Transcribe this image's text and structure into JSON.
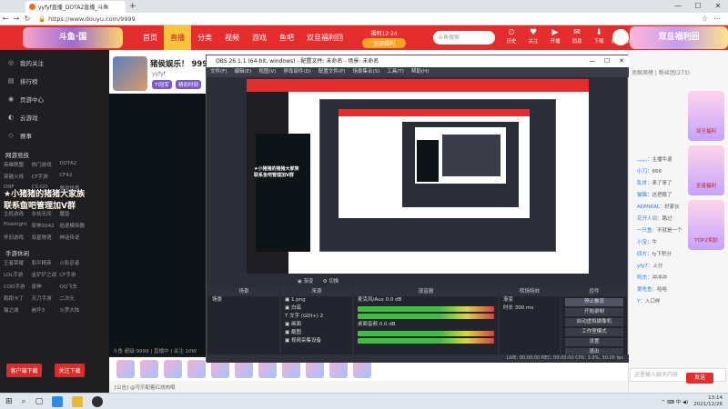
{
  "browser": {
    "tab_title": "yyfyf直播_DOTA2直播_斗鱼",
    "new_tab": "+",
    "window_buttons": [
      "—",
      "☐",
      "✕"
    ],
    "nav": [
      "←",
      "→",
      "↻"
    ],
    "url": "https://www.douyu.com/9999",
    "right_icons": [
      "☆",
      "⋯"
    ]
  },
  "douyu_header": {
    "logo": "斗鱼·国",
    "nav": [
      "首页",
      "直播",
      "分类",
      "视频",
      "游戏",
      "鱼吧",
      "双旦福利回"
    ],
    "active_nav": "直播",
    "promo_top": "福利12·24",
    "promo_btn": "全站福利",
    "search_placeholder": "斗鱼搜索",
    "icons": [
      {
        "glyph": "⏲",
        "label": "历史"
      },
      {
        "glyph": "♥",
        "label": "关注"
      },
      {
        "glyph": "▶",
        "label": "开播"
      },
      {
        "glyph": "✉",
        "label": "消息"
      },
      {
        "glyph": "⬇",
        "label": "下载"
      },
      {
        "glyph": "◆",
        "label": "超级合伙"
      }
    ],
    "banner": "双旦福利回"
  },
  "sidebar": {
    "items": [
      {
        "icon": "◎",
        "label": "我的关注"
      },
      {
        "icon": "▤",
        "label": "排行榜"
      },
      {
        "icon": "◉",
        "label": "页游中心"
      },
      {
        "icon": "◐",
        "label": "云游戏"
      },
      {
        "icon": "◇",
        "label": "赛事"
      }
    ],
    "sections": [
      {
        "title": "网游竞技",
        "items": [
          "英雄联盟",
          "热门游戏",
          "DOTA2",
          "穿越火线",
          "CF手游",
          "CF42",
          "DNF",
          "CS:GO",
          "魔兽世界"
        ]
      },
      {
        "title": "单机热游",
        "items": [
          "主机游戏",
          "永劫无间",
          "魔兽",
          "Pixelright",
          "原神2042",
          "追逐模拟器",
          "怀旧游戏",
          "双星物语",
          "神话传说"
        ]
      },
      {
        "title": "手游休闲",
        "items": [
          "王者荣耀",
          "和平精英",
          "火影忍者",
          "LOL手游",
          "金铲铲之战",
          "CF手游",
          "COD手游",
          "原神",
          "QQ飞车",
          "跑跑卡丁",
          "天刀手游",
          "二次元",
          "猫之城",
          "崩坏3",
          "斗罗大陆"
        ]
      }
    ],
    "bottom_buttons": [
      "客户端下载",
      "关注下载"
    ]
  },
  "room": {
    "title": "猪侯娱乐！ 9999",
    "sub": "yyfyf",
    "badges": [
      "TI冠军",
      "精彩时刻"
    ],
    "stats": "斗鱼 超级:9999 | 直播中 | 关注 10W"
  },
  "stream_overlay": {
    "line1": "★小猪猪的猪猪大家族",
    "line2": "联系鱼吧管理加V群"
  },
  "gift_bar": {
    "count": 11,
    "bottom": "[公告] @可乐配着红烧肉哦"
  },
  "right_panel": {
    "tabs": "贡献周榜  |  粉丝团(273)",
    "chat": [
      {
        "user": "灬灬",
        "text": "主播牛逼"
      },
      {
        "user": "小刀",
        "text": "666"
      },
      {
        "user": "乱世",
        "text": "来了来了"
      },
      {
        "user": "猫猫",
        "text": "这把稳了"
      },
      {
        "user": "ADMIRAL",
        "text": "好家伙"
      },
      {
        "user": "花开人间",
        "text": "路过"
      },
      {
        "user": "一只鱼",
        "text": "不就是一个"
      },
      {
        "user": "小宝",
        "text": "牛"
      },
      {
        "user": "四方",
        "text": "fy下积分"
      },
      {
        "user": "yfy7",
        "text": "上分"
      },
      {
        "user": "阿杰",
        "text": "冲冲冲"
      },
      {
        "user": "爱吃鱼",
        "text": "哈哈"
      },
      {
        "user": "Y",
        "text": "入口样"
      }
    ],
    "promos": [
      "双旦福利",
      "圣诞福利",
      "TOP2奖励"
    ],
    "input_placeholder": "这里输入聊天内容",
    "send_label": "发送"
  },
  "obs": {
    "title": "OBS 26.1.1 (64-bit, windows) - 配置文件: 未命名 - 场景: 未命名",
    "window_buttons": [
      "—",
      "☐",
      "✕"
    ],
    "menu": [
      "文件(F)",
      "编辑(E)",
      "视图(V)",
      "停靠部件(D)",
      "配置文件(P)",
      "场景集合(S)",
      "工具(T)",
      "帮助(H)"
    ],
    "transition": [
      "◉ 渐变",
      "⚙ 切换"
    ],
    "docks": [
      {
        "title": "场景",
        "rows": [
          "场景"
        ]
      },
      {
        "title": "来源",
        "rows": [
          "▣ 1.png",
          "▣ 白底",
          "T 文字 (GDI+) 2",
          "▣ 画面",
          "▣ 截图",
          "▣ 视频采集设备"
        ]
      },
      {
        "title": "混音器",
        "rows": [
          "麦克风/Aux  0.0 dB",
          "桌面音频  0.0 dB"
        ]
      },
      {
        "title": "转场特效",
        "rows": [
          "渐变",
          "时长  300 ms"
        ]
      },
      {
        "title": "控件",
        "rows": [
          "停止推流",
          "开始录制",
          "启动虚拟摄像机",
          "工作室模式",
          "设置",
          "退出"
        ]
      }
    ],
    "status": "LIVE: 00:00:00   REC: 00:00:00   CPU: 3.0%, 30.00 fps"
  },
  "taskbar": {
    "left": [
      "⊞",
      "⌕",
      "▢"
    ],
    "tray": "^ ⌨ 中 ◀)",
    "time": "13:14",
    "date": "2021/12/26"
  }
}
